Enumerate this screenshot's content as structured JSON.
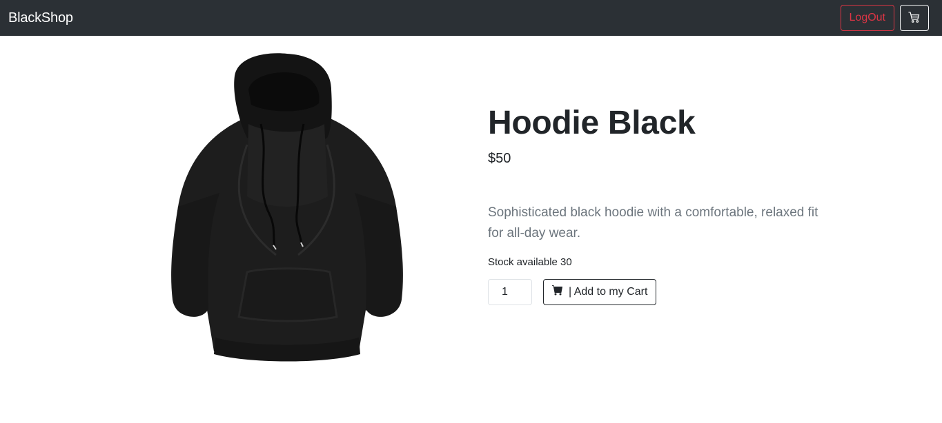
{
  "navbar": {
    "brand": "BlackShop",
    "logout_label": "LogOut",
    "cart_icon": "cart-icon"
  },
  "product": {
    "image_icon": "hoodie-image",
    "title": "Hoodie Black",
    "price": "$50",
    "description": "Sophisticated black hoodie with a comfortable, relaxed fit for all-day wear.",
    "stock": "Stock available 30",
    "quantity": "1",
    "add_to_cart_label": "| Add to my Cart",
    "add_icon": "cart-fill-icon"
  },
  "colors": {
    "navbar_bg": "#2b3035",
    "logout": "#dc3545",
    "text": "#212529",
    "muted": "#6c757d"
  }
}
